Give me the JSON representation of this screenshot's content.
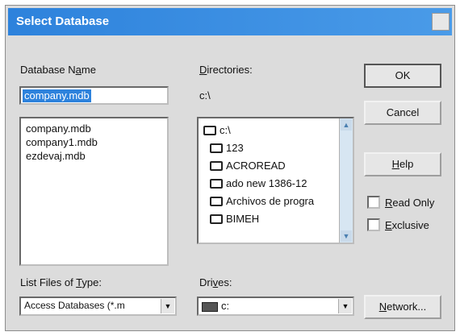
{
  "window": {
    "title": "Select Database"
  },
  "name_label": {
    "before": "Database N",
    "accel": "a",
    "after": "me"
  },
  "name_input": {
    "value": "company.mdb"
  },
  "files": [
    "company.mdb",
    "company1.mdb",
    "ezdevaj.mdb"
  ],
  "dir_label": {
    "accel": "D",
    "after": "irectories:"
  },
  "current_dir": "c:\\",
  "dirs": [
    "c:\\",
    "123",
    "ACROREAD",
    "ado new 1386-12",
    "Archivos de progra",
    "BIMEH"
  ],
  "buttons": {
    "ok": "OK",
    "cancel": "Cancel",
    "help_accel": "H",
    "help_rest": "elp",
    "network_accel": "N",
    "network_rest": "etwork..."
  },
  "checkboxes": {
    "readonly_accel": "R",
    "readonly_rest": "ead Only",
    "exclusive_accel": "E",
    "exclusive_rest": "xclusive"
  },
  "type_label": {
    "before": "List Files of ",
    "accel": "T",
    "after": "ype:"
  },
  "type_select": {
    "value": "Access Databases (*.m"
  },
  "drives_label": {
    "before": "Dri",
    "accel": "v",
    "after": "es:"
  },
  "drive_select": {
    "value": "c:"
  },
  "icons": {
    "drop_arrow": "▼",
    "scroll_up": "▲",
    "scroll_down": "▼"
  }
}
